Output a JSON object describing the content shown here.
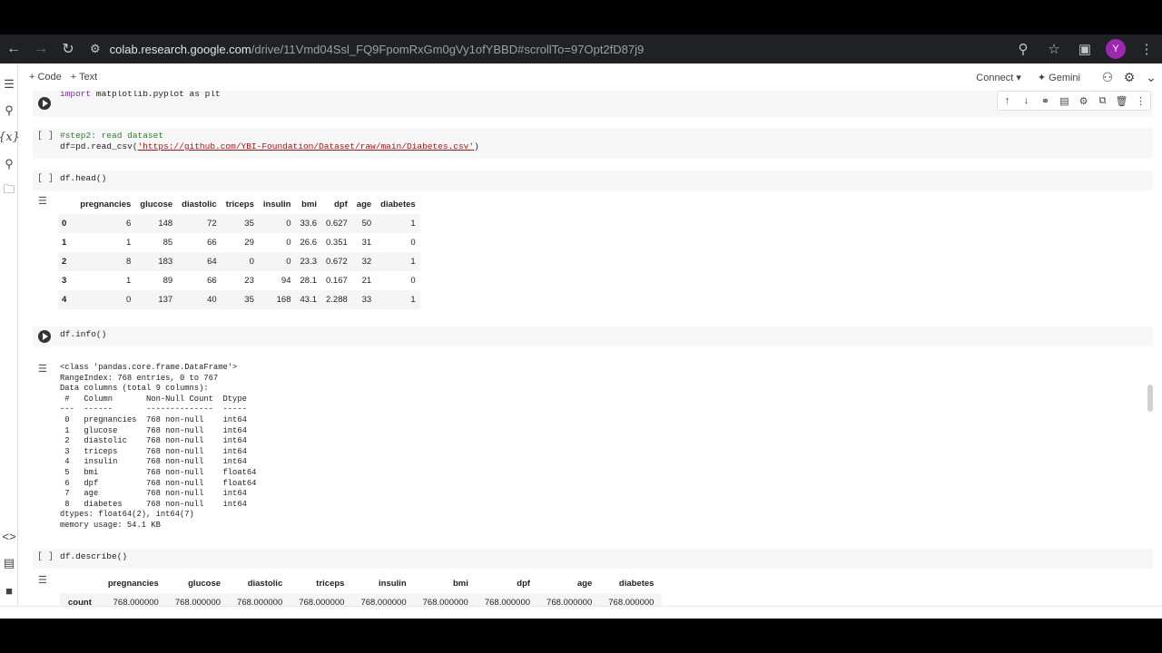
{
  "browser": {
    "url_host": "colab.research.google.com",
    "url_path": "/drive/11Vmd04Ssl_FQ9FpomRxGm0gVy1ofYBBD#scrollTo=97Opt2fD87j9",
    "avatar_letter": "Y"
  },
  "toolbar": {
    "code_label": "+ Code",
    "text_label": "+ Text",
    "connect_label": "Connect",
    "gemini_label": "Gemini"
  },
  "cells": {
    "import": {
      "keyword": "import",
      "code_rest": " matplotlib.pyplot as plt"
    },
    "read": {
      "gutter": "[ ]",
      "comment": "#step2: read dataset",
      "code_prefix": "df=pd.read_csv(",
      "url_string": "'https://github.com/YBI-Foundation/Dataset/raw/main/Diabetes.csv'",
      "code_suffix": ")"
    },
    "head": {
      "gutter": "[ ]",
      "code": "df.head()",
      "columns": [
        "pregnancies",
        "glucose",
        "diastolic",
        "triceps",
        "insulin",
        "bmi",
        "dpf",
        "age",
        "diabetes"
      ],
      "rows": [
        [
          "0",
          "6",
          "148",
          "72",
          "35",
          "0",
          "33.6",
          "0.627",
          "50",
          "1"
        ],
        [
          "1",
          "1",
          "85",
          "66",
          "29",
          "0",
          "26.6",
          "0.351",
          "31",
          "0"
        ],
        [
          "2",
          "8",
          "183",
          "64",
          "0",
          "0",
          "23.3",
          "0.672",
          "32",
          "1"
        ],
        [
          "3",
          "1",
          "89",
          "66",
          "23",
          "94",
          "28.1",
          "0.167",
          "21",
          "0"
        ],
        [
          "4",
          "0",
          "137",
          "40",
          "35",
          "168",
          "43.1",
          "2.288",
          "33",
          "1"
        ]
      ]
    },
    "info": {
      "code": "df.info()",
      "output": "<class 'pandas.core.frame.DataFrame'>\nRangeIndex: 768 entries, 0 to 767\nData columns (total 9 columns):\n #   Column       Non-Null Count  Dtype  \n---  ------       --------------  -----  \n 0   pregnancies  768 non-null    int64  \n 1   glucose      768 non-null    int64  \n 2   diastolic    768 non-null    int64  \n 3   triceps      768 non-null    int64  \n 4   insulin      768 non-null    int64  \n 5   bmi          768 non-null    float64\n 6   dpf          768 non-null    float64\n 7   age          768 non-null    int64  \n 8   diabetes     768 non-null    int64  \ndtypes: float64(2), int64(7)\nmemory usage: 54.1 KB"
    },
    "describe": {
      "gutter": "[ ]",
      "code": "df.describe()",
      "columns": [
        "pregnancies",
        "glucose",
        "diastolic",
        "triceps",
        "insulin",
        "bmi",
        "dpf",
        "age",
        "diabetes"
      ],
      "first_row_label": "count",
      "first_row": [
        "768.000000",
        "768.000000",
        "768.000000",
        "768.000000",
        "768.000000",
        "768.000000",
        "768.000000",
        "768.000000",
        "768.000000"
      ]
    }
  }
}
